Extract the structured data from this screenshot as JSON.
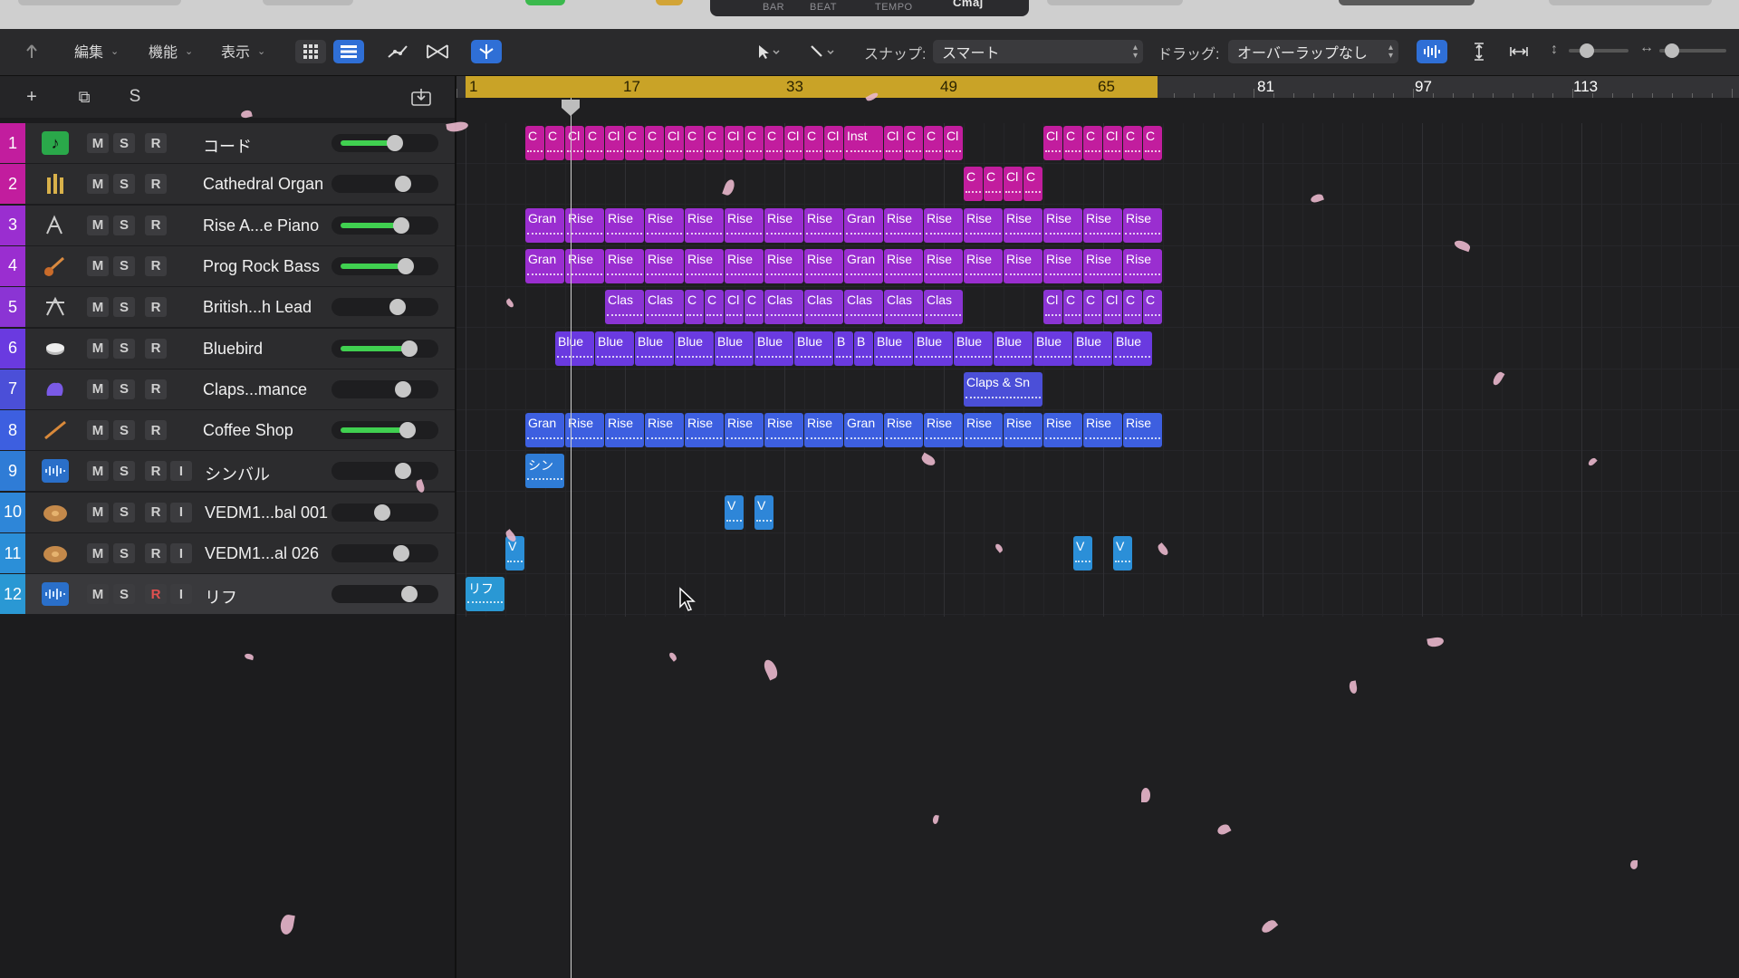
{
  "lcd": {
    "bar": "BAR",
    "beat": "BEAT",
    "tempo": "TEMPO",
    "key": "Cmaj"
  },
  "toolbar": {
    "edit": "編集",
    "functions": "機能",
    "view": "表示",
    "snap_label": "スナップ:",
    "snap_value": "スマート",
    "drag_label": "ドラッグ:",
    "drag_value": "オーバーラップなし"
  },
  "header": {
    "add": "+",
    "duplicate": "⧉",
    "solo": "S"
  },
  "ruler": {
    "bars": [
      "1",
      "17",
      "33",
      "49",
      "65",
      "81",
      "97",
      "113"
    ]
  },
  "tracks": [
    {
      "num": "1",
      "name": "コード",
      "icon": "music-note-icon",
      "fader": 0.62,
      "fader_on": true,
      "input": false,
      "color": "#c21d9e"
    },
    {
      "num": "2",
      "name": "Cathedral Organ",
      "icon": "organ-icon",
      "fader": 0.72,
      "fader_on": false,
      "input": false,
      "color": "#c21d9e"
    },
    {
      "num": "3",
      "name": "Rise A...e Piano",
      "icon": "piano-icon",
      "fader": 0.7,
      "fader_on": true,
      "input": false,
      "color": "#9a2ed0"
    },
    {
      "num": "4",
      "name": "Prog Rock Bass",
      "icon": "bass-guitar-icon",
      "fader": 0.75,
      "fader_on": true,
      "input": false,
      "color": "#9a2ed0"
    },
    {
      "num": "5",
      "name": "British...h Lead",
      "icon": "synth-icon",
      "fader": 0.65,
      "fader_on": false,
      "input": false,
      "color": "#8b34d4"
    },
    {
      "num": "6",
      "name": "Bluebird",
      "icon": "drum-kit-icon",
      "fader": 0.8,
      "fader_on": true,
      "input": false,
      "color": "#6a3ae0"
    },
    {
      "num": "7",
      "name": "Claps...mance",
      "icon": "clap-hand-icon",
      "fader": 0.72,
      "fader_on": false,
      "input": false,
      "color": "#4b4fd8"
    },
    {
      "num": "8",
      "name": "Coffee Shop",
      "icon": "drumstick-icon",
      "fader": 0.78,
      "fader_on": true,
      "input": false,
      "color": "#3d5fe0"
    },
    {
      "num": "9",
      "name": "シンバル",
      "icon": "waveform-icon",
      "fader": 0.72,
      "fader_on": false,
      "input": true,
      "color": "#2f7cd6"
    },
    {
      "num": "10",
      "name": "VEDM1...bal 001",
      "icon": "cymbal-icon",
      "fader": 0.45,
      "fader_on": false,
      "input": true,
      "color": "#2e86d8"
    },
    {
      "num": "11",
      "name": "VEDM1...al 026",
      "icon": "cymbal-icon",
      "fader": 0.7,
      "fader_on": false,
      "input": true,
      "color": "#2b8fd8"
    },
    {
      "num": "12",
      "name": "リフ",
      "icon": "waveform-icon",
      "fader": 0.8,
      "fader_on": false,
      "input": true,
      "color": "#2a98d4"
    }
  ],
  "regions": [
    {
      "track": 0,
      "labels": [
        "C",
        "C",
        "Cl",
        "C",
        "Cl",
        "C",
        "C",
        "Cl",
        "C",
        "C",
        "Cl",
        "C",
        "C",
        "Cl",
        "C",
        "Cl",
        "Inst",
        "Cl",
        "C",
        "C",
        "Cl"
      ],
      "start": 3,
      "color": "#c21d9e",
      "widths": [
        1,
        1,
        1,
        1,
        1,
        1,
        1,
        1,
        1,
        1,
        1,
        1,
        1,
        1,
        1,
        1,
        2,
        1,
        1,
        1,
        1
      ]
    },
    {
      "track": 0,
      "labels": [
        "Cl",
        "C",
        "C",
        "Cl",
        "C",
        "C"
      ],
      "start": 29,
      "color": "#c21d9e"
    },
    {
      "track": 1,
      "labels": [
        "C",
        "C",
        "Cl",
        "C"
      ],
      "start": 25,
      "color": "#c21d9e"
    },
    {
      "track": 2,
      "labels": [
        "Gran",
        "Rise",
        "Rise",
        "Rise",
        "Rise",
        "Rise",
        "Rise",
        "Rise",
        "Gran",
        "Rise",
        "Rise",
        "Rise",
        "Rise",
        "Rise",
        "Rise",
        "Rise"
      ],
      "start": 3,
      "color": "#9a2ed0",
      "widths": [
        2,
        2,
        2,
        2,
        2,
        2,
        2,
        2,
        2,
        2,
        2,
        2,
        2,
        2,
        2,
        2
      ]
    },
    {
      "track": 3,
      "labels": [
        "Gran",
        "Rise",
        "Rise",
        "Rise",
        "Rise",
        "Rise",
        "Rise",
        "Rise",
        "Gran",
        "Rise",
        "Rise",
        "Rise",
        "Rise",
        "Rise",
        "Rise",
        "Rise"
      ],
      "start": 3,
      "color": "#9a2ed0",
      "widths": [
        2,
        2,
        2,
        2,
        2,
        2,
        2,
        2,
        2,
        2,
        2,
        2,
        2,
        2,
        2,
        2
      ]
    },
    {
      "track": 4,
      "labels": [
        "Clas",
        "Clas",
        "C",
        "C",
        "Cl",
        "C",
        "Clas",
        "Clas",
        "Clas",
        "Clas",
        "Clas"
      ],
      "start": 7,
      "color": "#8b34d4",
      "widths": [
        2,
        2,
        1,
        1,
        1,
        1,
        2,
        2,
        2,
        2,
        2
      ]
    },
    {
      "track": 4,
      "labels": [
        "Cl",
        "C",
        "C",
        "Cl",
        "C",
        "C"
      ],
      "start": 29,
      "color": "#8b34d4"
    },
    {
      "track": 5,
      "labels": [
        "Blue",
        "Blue",
        "Blue",
        "Blue",
        "Blue",
        "Blue",
        "Blue",
        "B",
        "B",
        "Blue",
        "Blue",
        "Blue",
        "Blue",
        "Blue",
        "Blue",
        "Blue"
      ],
      "start": 4.5,
      "color": "#6a3ae0",
      "widths": [
        2,
        2,
        2,
        2,
        2,
        2,
        2,
        1,
        1,
        2,
        2,
        2,
        2,
        2,
        2,
        2
      ]
    },
    {
      "track": 6,
      "labels": [
        "Claps & Sn"
      ],
      "start": 25,
      "color": "#4b4fd8",
      "widths": [
        4
      ]
    },
    {
      "track": 7,
      "labels": [
        "Gran",
        "Rise",
        "Rise",
        "Rise",
        "Rise",
        "Rise",
        "Rise",
        "Rise",
        "Gran",
        "Rise",
        "Rise",
        "Rise",
        "Rise",
        "Rise",
        "Rise",
        "Rise"
      ],
      "start": 3,
      "color": "#3d5fe0",
      "widths": [
        2,
        2,
        2,
        2,
        2,
        2,
        2,
        2,
        2,
        2,
        2,
        2,
        2,
        2,
        2,
        2
      ]
    },
    {
      "track": 8,
      "labels": [
        "シン"
      ],
      "start": 3,
      "color": "#2f7cd6",
      "widths": [
        2
      ]
    },
    {
      "track": 9,
      "labels": [
        "V",
        "V"
      ],
      "start": 13,
      "color": "#2e86d8",
      "gaps": [
        0,
        0.5
      ]
    },
    {
      "track": 10,
      "labels": [
        "V"
      ],
      "start": 2,
      "color": "#2b8fd8"
    },
    {
      "track": 10,
      "labels": [
        "V",
        "V"
      ],
      "start": 30.5,
      "color": "#2b8fd8",
      "gaps": [
        0,
        1
      ]
    },
    {
      "track": 11,
      "labels": [
        "リフ"
      ],
      "start": 0,
      "color": "#2a98d4",
      "widths": [
        2
      ]
    }
  ]
}
